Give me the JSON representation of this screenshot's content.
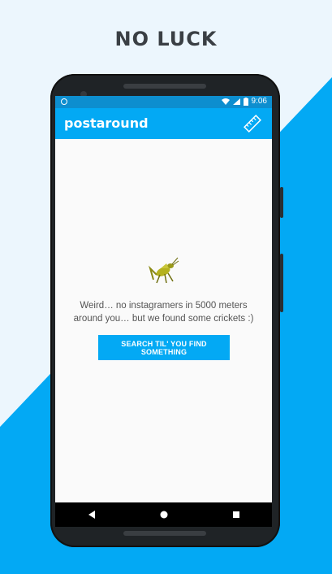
{
  "headline": "NO LUCK",
  "status_bar": {
    "time": "9:06"
  },
  "app_bar": {
    "title": "postaround"
  },
  "content": {
    "message": "Weird… no instagramers in 5000 meters around you… but we found some crickets :)",
    "button_label": "SEARCH TIL' YOU FIND SOMETHING"
  },
  "colors": {
    "accent": "#03a9f4",
    "status_bar": "#0d8ecf",
    "background_light": "#ecf6fd",
    "background_blue": "#03a9f4"
  },
  "icons": [
    "ruler-icon",
    "cricket-icon",
    "back-icon",
    "home-icon",
    "recents-icon",
    "wifi-icon",
    "signal-icon",
    "battery-icon"
  ]
}
